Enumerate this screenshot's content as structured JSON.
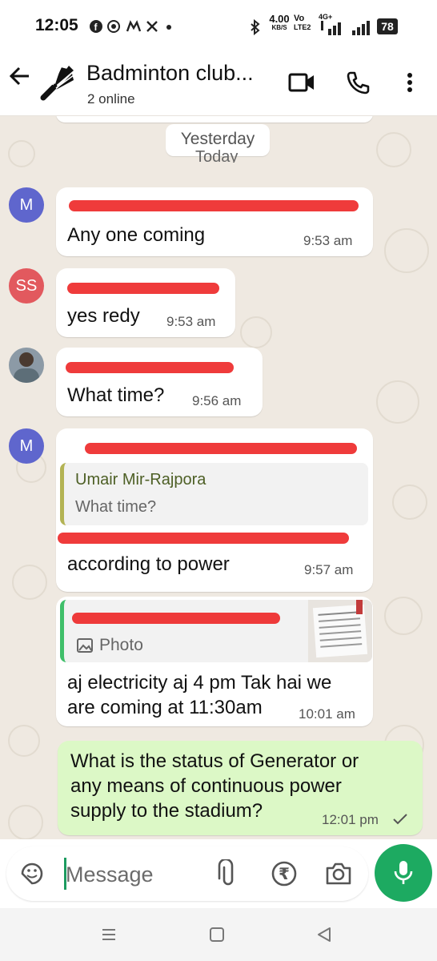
{
  "status_bar": {
    "time": "12:05",
    "net_speed_value": "4.00",
    "net_speed_unit": "KB/S",
    "volte_top": "Vo",
    "volte_bottom": "LTE2",
    "signal_label": "4G+",
    "battery": "78"
  },
  "header": {
    "title": "Badminton club...",
    "subtitle": "2 online"
  },
  "chat": {
    "date_chip": "Yesterday",
    "today_peek": "Today",
    "messages": [
      {
        "avatar": "M",
        "avatar_color": "#5f66cd",
        "text": "Any one coming",
        "time": "9:53 am"
      },
      {
        "avatar": "SS",
        "avatar_color": "#e2595e",
        "text": "yes redy",
        "time": "9:53 am"
      },
      {
        "text": "What time?",
        "time": "9:56 am"
      },
      {
        "avatar": "M",
        "avatar_color": "#5f66cd",
        "quote_name": "Umair Mir-Rajpora",
        "quote_text": "What time?",
        "text": "according to power",
        "time": "9:57 am"
      },
      {
        "quote_text": "Photo",
        "text_line1": "aj electricity aj 4 pm Tak hai we",
        "text_line2": "are coming at 11:30am",
        "time": "10:01 am"
      },
      {
        "text_line1": "What is the status of Generator or",
        "text_line2": "any means of continuous power",
        "text_line3": "supply to the stadium?",
        "time": "12:01 pm"
      }
    ]
  },
  "input": {
    "placeholder": "Message"
  },
  "colors": {
    "accent": "#1daa61",
    "outgoing_bubble": "#dcf8c6",
    "chat_background": "#efe9e1"
  },
  "icons": [
    "facebook-icon",
    "whatsapp-icon",
    "messenger-icon",
    "x-icon",
    "bluetooth-icon",
    "video-call-icon",
    "phone-icon",
    "more-vert-icon",
    "sticker-icon",
    "attach-icon",
    "rupee-icon",
    "camera-icon",
    "mic-icon",
    "read-check-icon"
  ]
}
